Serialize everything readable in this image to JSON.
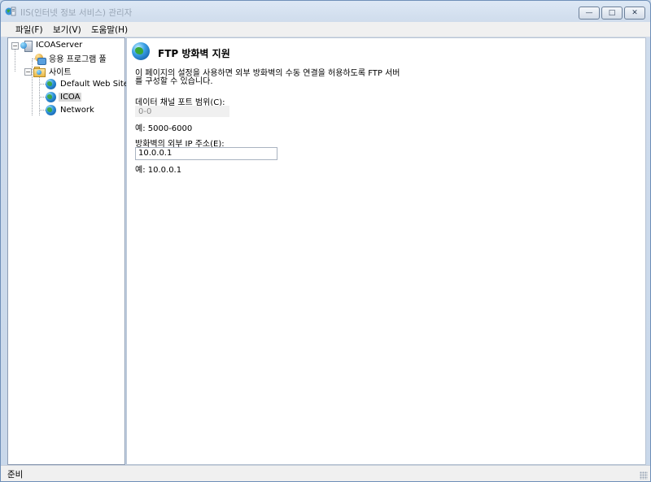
{
  "window": {
    "title": "IIS(인터넷 정보 서비스) 관리자",
    "buttons": {
      "minimize": "—",
      "maximize": "□",
      "close": "✕"
    }
  },
  "menubar": {
    "items": [
      {
        "label": "파일(F)"
      },
      {
        "label": "보기(V)"
      },
      {
        "label": "도움말(H)"
      }
    ]
  },
  "tree": {
    "server": "ICOAServer",
    "app_pools": "응용 프로그램 풀",
    "sites": "사이트",
    "site_items": [
      "Default Web Site",
      "ICOA",
      "Network"
    ],
    "selected": "ICOA"
  },
  "content": {
    "title": "FTP 방화벽 지원",
    "description_line1": "이 페이지의 설정을 사용하면 외부 방화벽의 수동 연결을 허용하도록 FTP 서버",
    "description_line2": "를 구성할 수 있습니다.",
    "port_range": {
      "label_prefix": "데이터 채널 포트 범위(",
      "label_key": "C",
      "label_suffix": "):",
      "value": "0-0",
      "example": "예: 5000-6000"
    },
    "external_ip": {
      "label_prefix": "방화벽의 외부 IP 주소(",
      "label_key": "E",
      "label_suffix": "):",
      "value": "10.0.0.1",
      "example": "예: 10.0.0.1"
    }
  },
  "statusbar": {
    "text": "준비"
  },
  "colors": {
    "titlebar": "#dde8f5",
    "frame": "#c9d8ea",
    "selection": "#d9d9d9"
  }
}
